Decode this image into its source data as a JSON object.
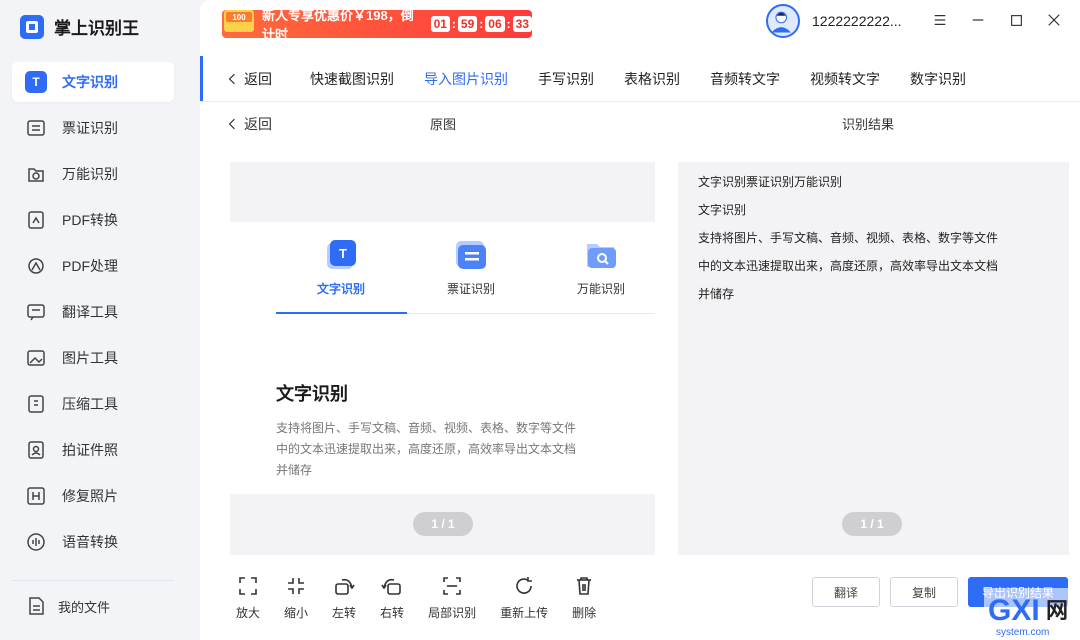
{
  "app": {
    "name": "掌上识别王"
  },
  "sidebar": {
    "items": [
      {
        "label": "文字识别",
        "icon": "text-recognition-icon",
        "active": true
      },
      {
        "label": "票证识别",
        "icon": "ticket-icon"
      },
      {
        "label": "万能识别",
        "icon": "universal-scan-icon"
      },
      {
        "label": "PDF转换",
        "icon": "pdf-convert-icon"
      },
      {
        "label": "PDF处理",
        "icon": "pdf-process-icon"
      },
      {
        "label": "翻译工具",
        "icon": "translate-icon"
      },
      {
        "label": "图片工具",
        "icon": "image-tool-icon"
      },
      {
        "label": "压缩工具",
        "icon": "compress-icon"
      },
      {
        "label": "拍证件照",
        "icon": "id-photo-icon"
      },
      {
        "label": "修复照片",
        "icon": "repair-photo-icon"
      },
      {
        "label": "语音转换",
        "icon": "voice-convert-icon"
      }
    ],
    "my_files": "我的文件"
  },
  "header": {
    "promo": {
      "badge": "100",
      "text": "新人专享优惠价￥198，倒计时",
      "timer": [
        "01",
        "59",
        "06",
        "33"
      ]
    },
    "username": "1222222222..."
  },
  "tabs": {
    "back": "返回",
    "items": [
      "快速截图识别",
      "导入图片识别",
      "手写识别",
      "表格识别",
      "音频转文字",
      "视频转文字",
      "数字识别"
    ],
    "active_index": 1
  },
  "subhead": {
    "back": "返回",
    "original": "原图",
    "result": "识别结果"
  },
  "original_doc": {
    "tabs": [
      "文字识别",
      "票证识别",
      "万能识别"
    ],
    "title": "文字识别",
    "desc": [
      "支持将图片、手写文稿、音频、视频、表格、数字等文件",
      "中的文本迅速提取出来，高度还原，高效率导出文本文档",
      "并储存"
    ],
    "pager": "1 / 1"
  },
  "result": {
    "lines": [
      "文字识别票证识别万能识别",
      "文字识别",
      "支持将图片、手写文稿、音频、视频、表格、数字等文件",
      "中的文本迅速提取出来，高度还原，高效率导出文本文档",
      "并储存"
    ],
    "pager": "1 / 1"
  },
  "toolbar": {
    "zoom_in": "放大",
    "zoom_out": "缩小",
    "rotate_left": "左转",
    "rotate_right": "右转",
    "partial": "局部识别",
    "reupload": "重新上传",
    "delete": "删除"
  },
  "actions": {
    "translate": "翻译",
    "copy": "复制",
    "export": "导出识别结果"
  },
  "watermark": "GXI网 system.com",
  "colors": {
    "accent": "#2f6cf6",
    "promo": "#ff4a3d"
  }
}
